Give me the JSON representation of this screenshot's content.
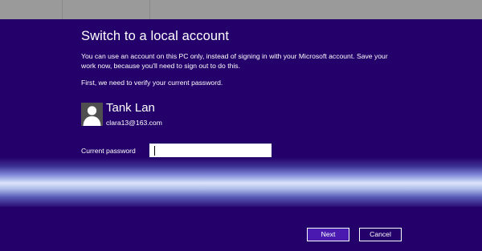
{
  "dialog": {
    "title": "Switch to a local account",
    "description": "You can use an account on this PC only, instead of signing in with your Microsoft account. Save your work now, because you'll need to sign out to do this.",
    "verify_text": "First, we need to verify your current password."
  },
  "user": {
    "name": "Tank Lan",
    "email": "clara13@163.com",
    "avatar_icon": "user-silhouette-icon"
  },
  "password": {
    "label": "Current password",
    "value": ""
  },
  "buttons": {
    "next_label": "Next",
    "cancel_label": "Cancel"
  },
  "colors": {
    "background": "#23006a",
    "top_bar": "#9a9a9a",
    "next_button": "#4a1ab0",
    "text": "#ffffff"
  }
}
